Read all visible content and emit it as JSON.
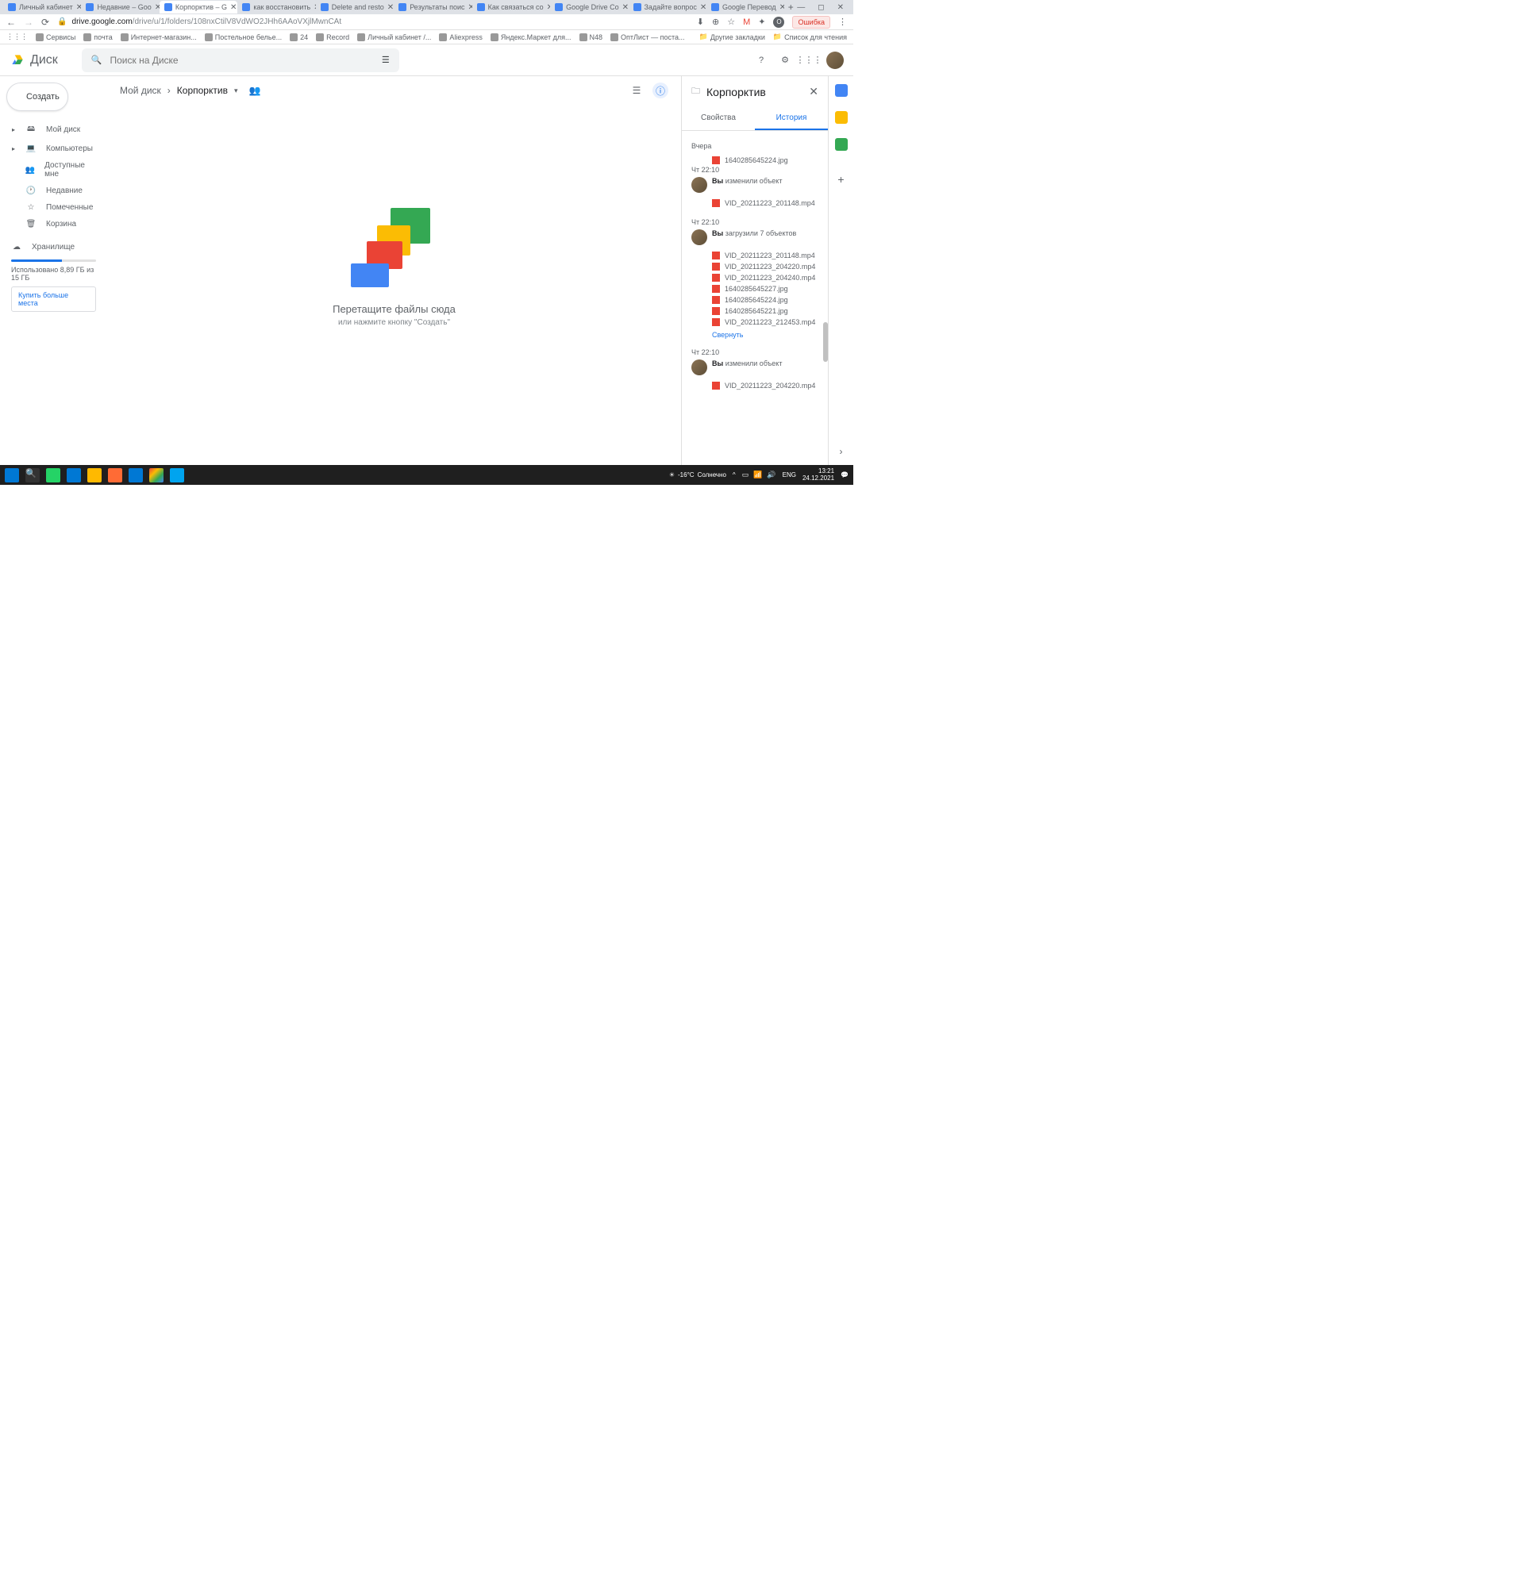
{
  "browser": {
    "tabs": [
      {
        "label": "Личный кабинет"
      },
      {
        "label": "Недавние – Goo"
      },
      {
        "label": "Корпорктив – G",
        "active": true
      },
      {
        "label": "как восстановить"
      },
      {
        "label": "Delete and resto"
      },
      {
        "label": "Результаты поис"
      },
      {
        "label": "Как связаться со"
      },
      {
        "label": "Google Drive Co"
      },
      {
        "label": "Задайте вопрос"
      },
      {
        "label": "Google Перевод"
      }
    ],
    "url_host": "drive.google.com",
    "url_path": "/drive/u/1/folders/108nxCtilV8VdWO2JHh6AAoVXjlMwnCAt",
    "error_label": "Ошибка",
    "bookmarks": [
      "Сервисы",
      "почта",
      "Интернет-магазин...",
      "Постельное белье...",
      "24",
      "Record",
      "Личный кабинет /...",
      "Aliexpress",
      "Яндекс.Маркет для...",
      "N48",
      "ОптЛист — поста..."
    ],
    "bookmarks_right": [
      "Другие закладки",
      "Список для чтения"
    ]
  },
  "drive": {
    "brand": "Диск",
    "search_placeholder": "Поиск на Диске",
    "create_label": "Создать",
    "nav": [
      {
        "icon": "▸",
        "glyph": "🖴",
        "label": "Мой диск",
        "expandable": true
      },
      {
        "icon": "▸",
        "glyph": "💻",
        "label": "Компьютеры",
        "expandable": true
      },
      {
        "icon": "",
        "glyph": "👥",
        "label": "Доступные мне"
      },
      {
        "icon": "",
        "glyph": "🕐",
        "label": "Недавние"
      },
      {
        "icon": "",
        "glyph": "☆",
        "label": "Помеченные"
      },
      {
        "icon": "",
        "glyph": "🗑",
        "label": "Корзина"
      }
    ],
    "storage": {
      "label": "Хранилище",
      "usage": "Использовано 8,89 ГБ из 15 ГБ",
      "buy": "Купить больше места"
    },
    "breadcrumb": {
      "root": "Мой диск",
      "current": "Корпорктив"
    },
    "empty": {
      "title": "Перетащите файлы сюда",
      "sub": "или нажмите кнопку \"Создать\""
    }
  },
  "details": {
    "title": "Корпорктив",
    "tabs": {
      "props": "Свойства",
      "hist": "История"
    },
    "day_label": "Вчера",
    "first_file": "1640285645224.jpg",
    "events": [
      {
        "time": "Чт 22:10",
        "actor": "Вы",
        "action": "изменили объект",
        "files": [
          {
            "name": "VID_20211223_201148.mp4",
            "t": "vid"
          }
        ]
      },
      {
        "time": "Чт 22:10",
        "actor": "Вы",
        "action": "загрузили 7 объектов",
        "files": [
          {
            "name": "VID_20211223_201148.mp4",
            "t": "vid"
          },
          {
            "name": "VID_20211223_204220.mp4",
            "t": "vid"
          },
          {
            "name": "VID_20211223_204240.mp4",
            "t": "vid"
          },
          {
            "name": "1640285645227.jpg",
            "t": "img"
          },
          {
            "name": "1640285645224.jpg",
            "t": "img"
          },
          {
            "name": "1640285645221.jpg",
            "t": "img"
          },
          {
            "name": "VID_20211223_212453.mp4",
            "t": "vid"
          }
        ],
        "collapse": "Свернуть"
      },
      {
        "time": "Чт 22:10",
        "actor": "Вы",
        "action": "изменили объект",
        "files": [
          {
            "name": "VID_20211223_204220.mp4",
            "t": "vid"
          }
        ]
      }
    ]
  },
  "taskbar": {
    "weather": {
      "temp": "-16°C",
      "cond": "Солнечно"
    },
    "lang": "ENG",
    "time": "13:21",
    "date": "24.12.2021"
  }
}
